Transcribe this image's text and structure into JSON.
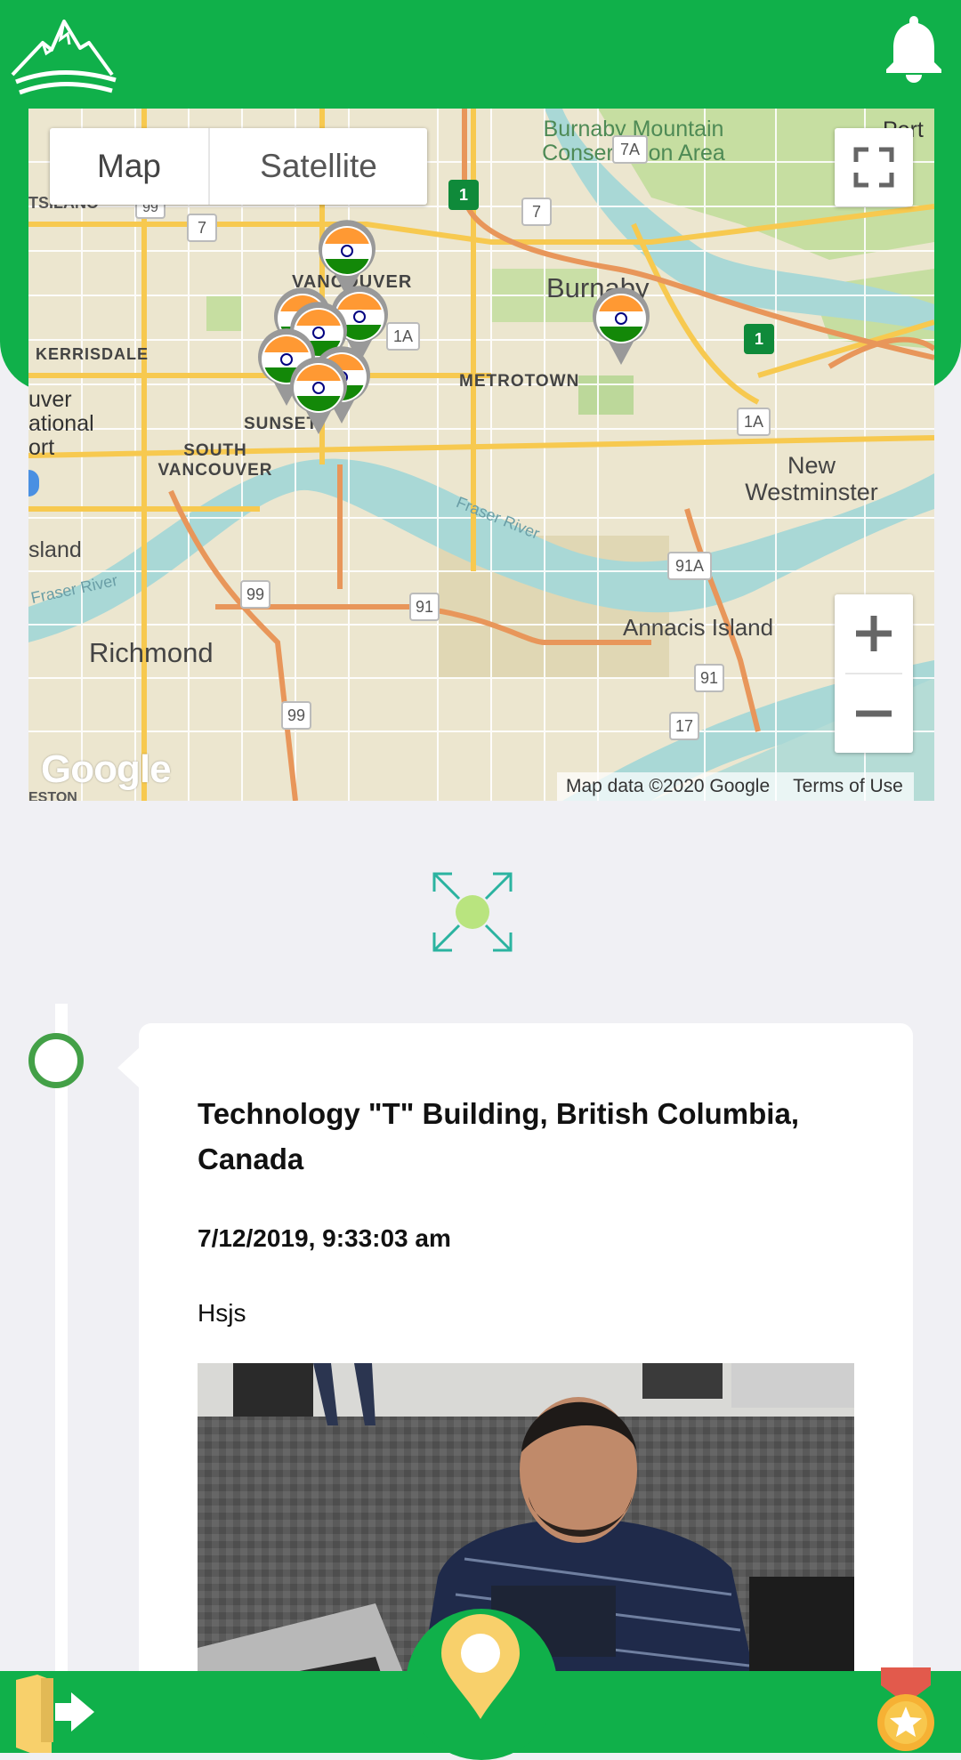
{
  "header": {
    "logo_icon": "mountain-logo-icon",
    "notification_icon": "bell-icon"
  },
  "map": {
    "map_type_map": "Map",
    "map_type_satellite": "Satellite",
    "fullscreen_icon": "fullscreen-icon",
    "zoom_in_label": "+",
    "zoom_out_label": "−",
    "attribution": "Map data ©2020 Google",
    "terms": "Terms of Use",
    "watermark": "Google",
    "labels": {
      "burnaby": "Burnaby",
      "burnaby_mountain": "Burnaby Mountain Conservation Area",
      "vancouver": "VANCOUVER",
      "kerrisdale": "KERRISDALE",
      "metrotown": "METROTOWN",
      "south_vancouver": "SOUTH VANCOUVER",
      "sunset": "SUNSET",
      "new_westminster": "New Westminster",
      "fraser_river": "Fraser River",
      "richmond": "Richmond",
      "annacis_island": "Annacis Island",
      "island": "sland",
      "tsilano": "TSILANO",
      "port_moody": "Port M",
      "vancouver_intl": "uver ational ort",
      "eston": "ESTON"
    },
    "route_shields": [
      "7A",
      "7",
      "7",
      "1A",
      "1A",
      "91A",
      "91",
      "91",
      "99",
      "99",
      "99",
      "17",
      "1",
      "1"
    ],
    "marker_flag_colors": [
      "#ff9933",
      "#ffffff",
      "#138808",
      "#000080"
    ]
  },
  "colors": {
    "brand_green": "#10b04a",
    "timeline_green": "#43a047",
    "pin_yellow": "#f8d06b",
    "expand_teal": "#2bb3a0",
    "expand_dot": "#b9e47f"
  },
  "post": {
    "title": "Technology \"T\" Building, British Columbia, Canada",
    "datetime": "7/12/2019, 9:33:03 am",
    "note": "Hsjs",
    "photo_icon": "photo-man-laptop"
  },
  "bottom_nav": {
    "logout_icon": "logout-door-icon",
    "location_icon": "location-pin-icon",
    "badge_icon": "medal-star-icon"
  }
}
